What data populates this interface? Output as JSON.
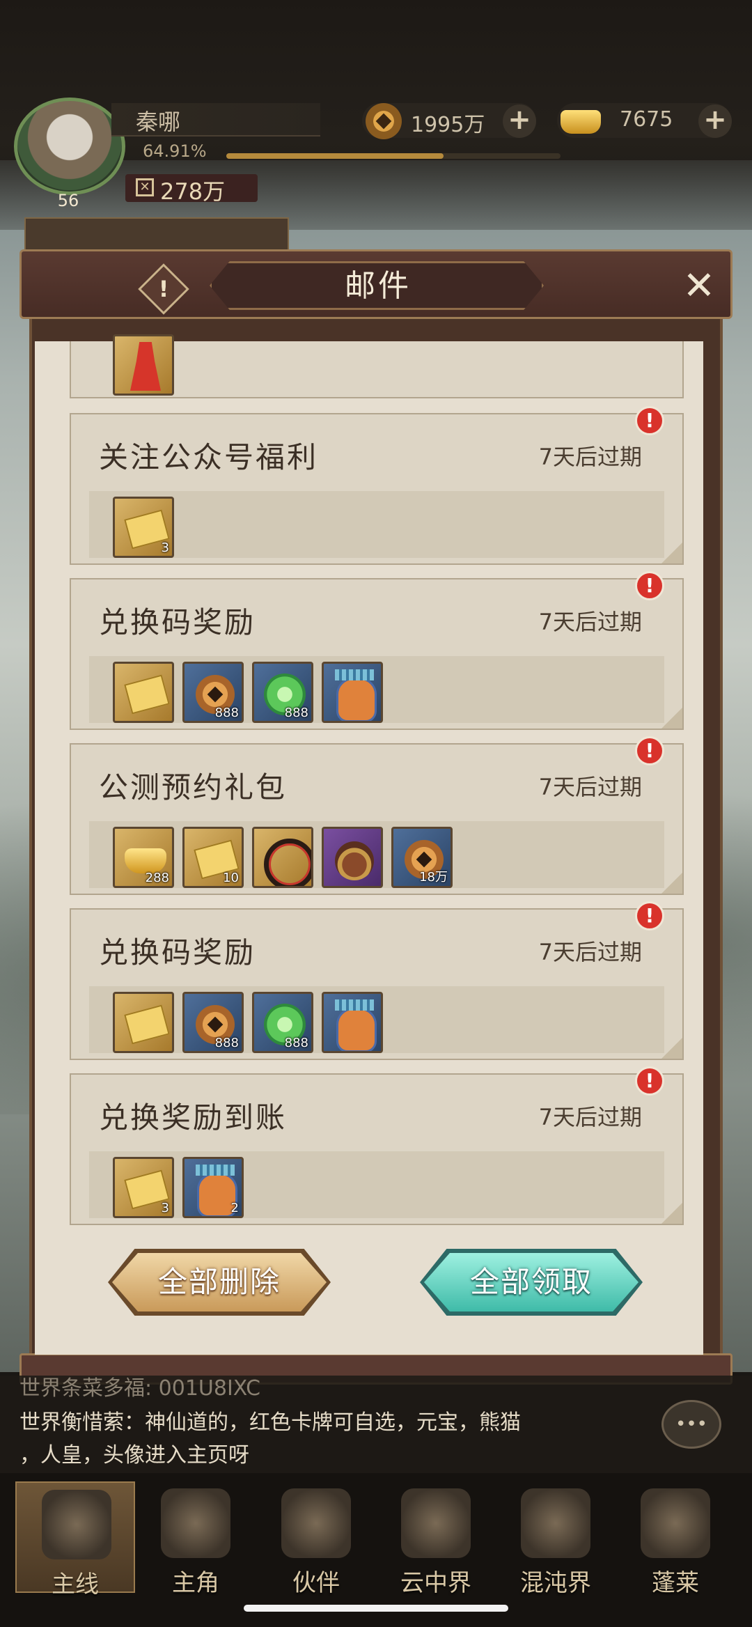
{
  "player": {
    "name": "秦哪",
    "level": "56",
    "exp_percent": "64.91%",
    "exp_fraction": 0.6491,
    "power": "278万"
  },
  "currency": {
    "copper": "1995万",
    "ingot": "7675"
  },
  "modal": {
    "title": "邮件"
  },
  "mails": [
    {
      "title": "关注公众号福利",
      "expiry": "7天后过期",
      "badge": "!",
      "items": [
        {
          "icon": "ticket-icon",
          "count": "3",
          "quality": "gold"
        }
      ]
    },
    {
      "title": "兑换码奖励",
      "expiry": "7天后过期",
      "badge": "!",
      "items": [
        {
          "icon": "ticket-icon",
          "count": "",
          "quality": "gold"
        },
        {
          "icon": "copper-coin-icon",
          "count": "888",
          "quality": "blue"
        },
        {
          "icon": "jade-orb-icon",
          "count": "888",
          "quality": "blue"
        },
        {
          "icon": "mascot-icon",
          "count": "",
          "quality": "blue"
        }
      ]
    },
    {
      "title": "公测预约礼包",
      "expiry": "7天后过期",
      "badge": "!",
      "items": [
        {
          "icon": "gold-ingot-icon",
          "count": "288",
          "quality": "gold"
        },
        {
          "icon": "ticket-icon",
          "count": "10",
          "quality": "gold"
        },
        {
          "icon": "ring-icon",
          "count": "",
          "quality": "gold"
        },
        {
          "icon": "beast-icon",
          "count": "",
          "quality": "purple"
        },
        {
          "icon": "copper-coin-icon",
          "count": "18万",
          "quality": "blue"
        }
      ]
    },
    {
      "title": "兑换码奖励",
      "expiry": "7天后过期",
      "badge": "!",
      "items": [
        {
          "icon": "ticket-icon",
          "count": "",
          "quality": "gold"
        },
        {
          "icon": "copper-coin-icon",
          "count": "888",
          "quality": "blue"
        },
        {
          "icon": "jade-orb-icon",
          "count": "888",
          "quality": "blue"
        },
        {
          "icon": "mascot-icon",
          "count": "",
          "quality": "blue"
        }
      ]
    },
    {
      "title": "兑换奖励到账",
      "expiry": "7天后过期",
      "badge": "!",
      "items": [
        {
          "icon": "ticket-icon",
          "count": "3",
          "quality": "gold"
        },
        {
          "icon": "mascot-icon",
          "count": "2",
          "quality": "blue"
        }
      ]
    }
  ],
  "buttons": {
    "delete_all": "全部删除",
    "claim_all": "全部领取"
  },
  "chat": {
    "line1_channel": "世界",
    "line1_text": "条菜多福: 001U8IXC",
    "line2_channel": "世界",
    "line2_name": "衡惜萦",
    "line2_text": "神仙道的，红色卡牌可自选，元宝，熊猫",
    "line3_text": "人皇，头像进入主页呀"
  },
  "tabs": [
    "主线",
    "主角",
    "伙伴",
    "云中界",
    "混沌界",
    "蓬莱"
  ]
}
